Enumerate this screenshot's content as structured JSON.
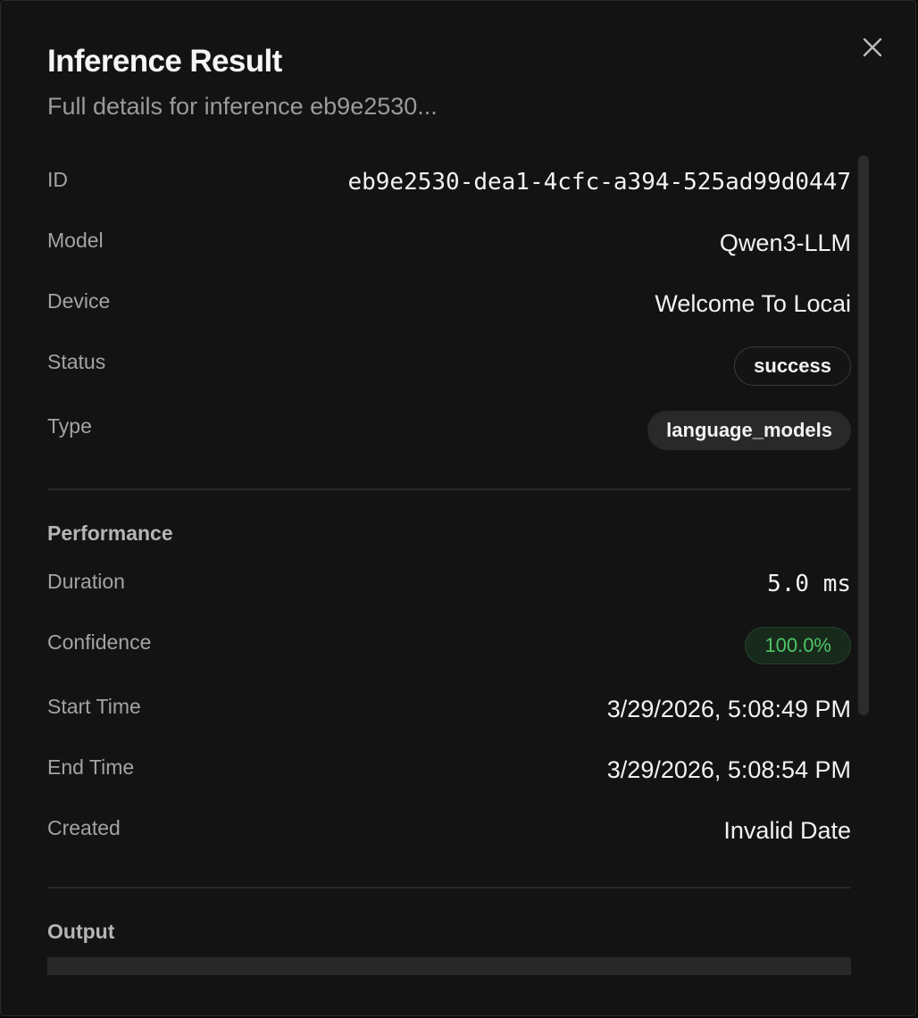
{
  "dialog": {
    "title": "Inference Result",
    "subtitle": "Full details for inference eb9e2530..."
  },
  "details": {
    "id_label": "ID",
    "id_value": "eb9e2530-dea1-4cfc-a394-525ad99d0447",
    "model_label": "Model",
    "model_value": "Qwen3-LLM",
    "device_label": "Device",
    "device_value": "Welcome To Locai",
    "status_label": "Status",
    "status_value": "success",
    "type_label": "Type",
    "type_value": "language_models"
  },
  "performance": {
    "section_title": "Performance",
    "duration_label": "Duration",
    "duration_value": "5.0 ms",
    "confidence_label": "Confidence",
    "confidence_value": "100.0%",
    "start_label": "Start Time",
    "start_value": "3/29/2026, 5:08:49 PM",
    "end_label": "End Time",
    "end_value": "3/29/2026, 5:08:54 PM",
    "created_label": "Created",
    "created_value": "Invalid Date"
  },
  "output": {
    "section_title": "Output"
  },
  "icons": {
    "close": "close-icon"
  },
  "colors": {
    "background": "#131313",
    "success_text": "#4fc468"
  }
}
